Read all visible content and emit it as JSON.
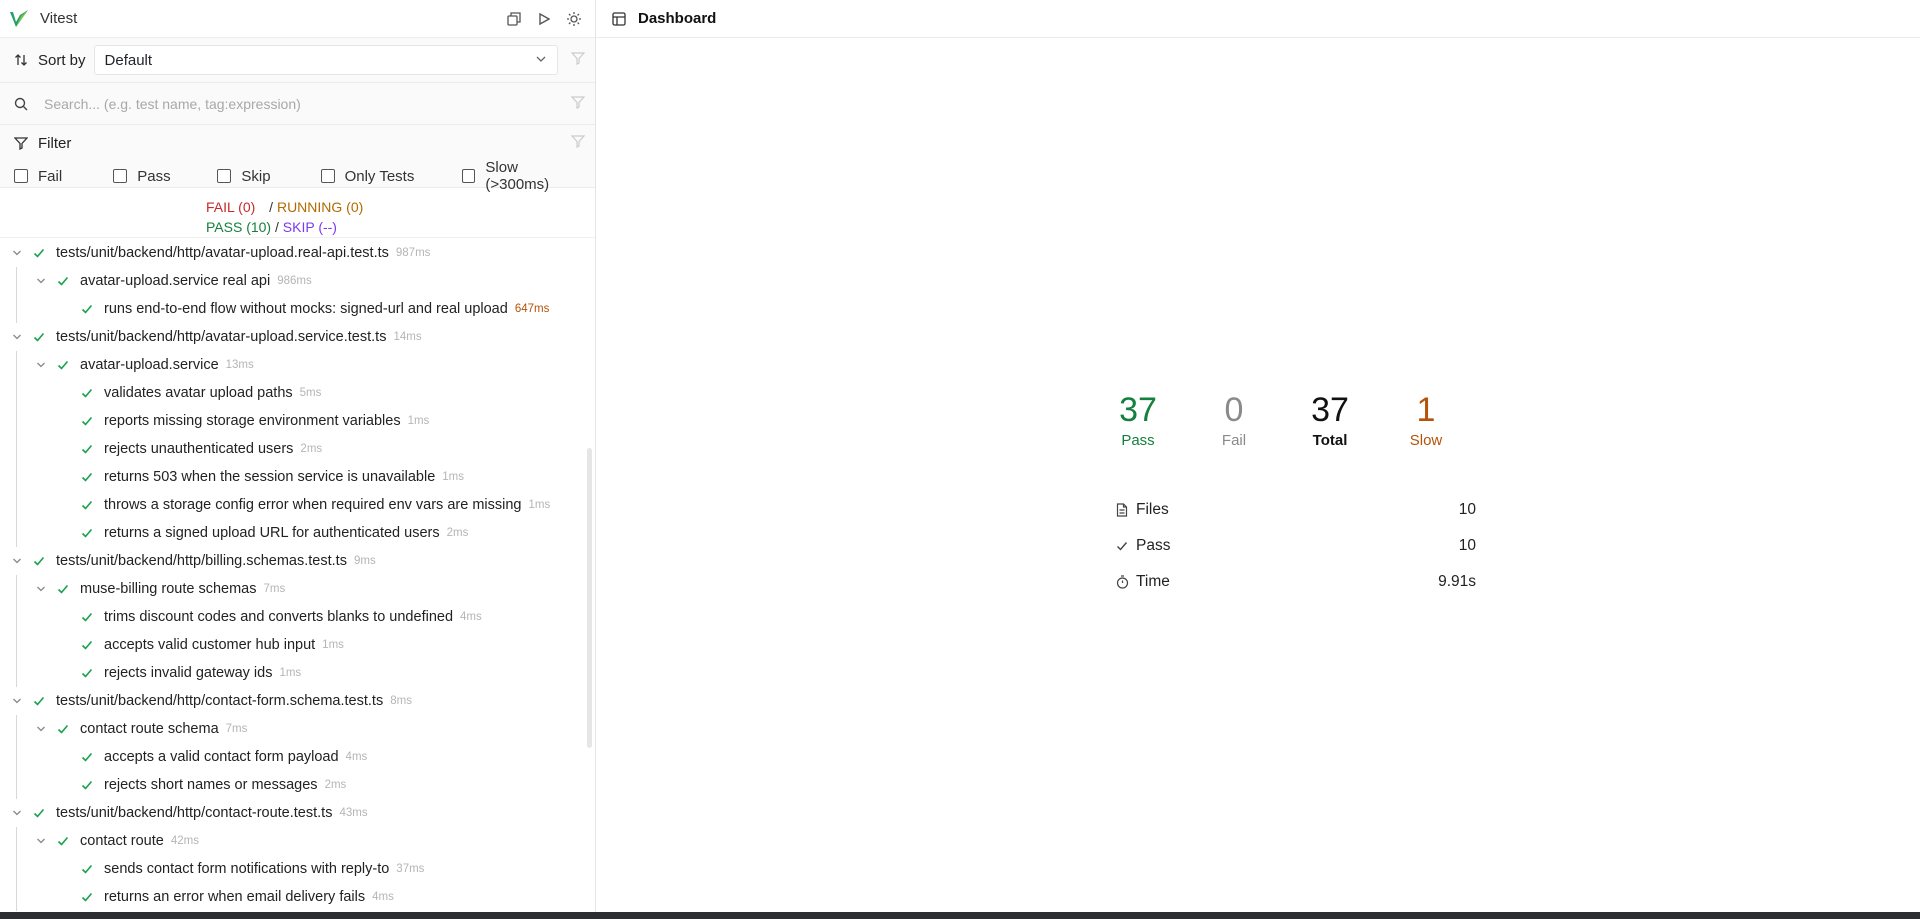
{
  "app": {
    "title": "Vitest"
  },
  "sidebar": {
    "sort_label": "Sort by",
    "sort_value": "Default",
    "search_placeholder": "Search... (e.g. test name, tag:expression)",
    "filter_title": "Filter",
    "filter_options": [
      "Fail",
      "Pass",
      "Skip",
      "Only Tests",
      "Slow (>300ms)"
    ],
    "summary": {
      "fail": "FAIL (0)",
      "sep1": "/",
      "running": "RUNNING (0)",
      "pass": "PASS (10)",
      "sep2": "/",
      "skip": "SKIP (--)"
    },
    "tree": [
      {
        "level": 0,
        "name": "tests/unit/backend/http/avatar-upload.real-api.test.ts",
        "dur": "987ms"
      },
      {
        "level": 1,
        "name": "avatar-upload.service real api",
        "dur": "986ms"
      },
      {
        "level": 2,
        "name": "runs end-to-end flow without mocks: signed-url and real upload",
        "dur": "647ms",
        "slow": true
      },
      {
        "level": 0,
        "name": "tests/unit/backend/http/avatar-upload.service.test.ts",
        "dur": "14ms"
      },
      {
        "level": 1,
        "name": "avatar-upload.service",
        "dur": "13ms"
      },
      {
        "level": 2,
        "name": "validates avatar upload paths",
        "dur": "5ms"
      },
      {
        "level": 2,
        "name": "reports missing storage environment variables",
        "dur": "1ms"
      },
      {
        "level": 2,
        "name": "rejects unauthenticated users",
        "dur": "2ms"
      },
      {
        "level": 2,
        "name": "returns 503 when the session service is unavailable",
        "dur": "1ms"
      },
      {
        "level": 2,
        "name": "throws a storage config error when required env vars are missing",
        "dur": "1ms"
      },
      {
        "level": 2,
        "name": "returns a signed upload URL for authenticated users",
        "dur": "2ms"
      },
      {
        "level": 0,
        "name": "tests/unit/backend/http/billing.schemas.test.ts",
        "dur": "9ms"
      },
      {
        "level": 1,
        "name": "muse-billing route schemas",
        "dur": "7ms"
      },
      {
        "level": 2,
        "name": "trims discount codes and converts blanks to undefined",
        "dur": "4ms"
      },
      {
        "level": 2,
        "name": "accepts valid customer hub input",
        "dur": "1ms"
      },
      {
        "level": 2,
        "name": "rejects invalid gateway ids",
        "dur": "1ms"
      },
      {
        "level": 0,
        "name": "tests/unit/backend/http/contact-form.schema.test.ts",
        "dur": "8ms"
      },
      {
        "level": 1,
        "name": "contact route schema",
        "dur": "7ms"
      },
      {
        "level": 2,
        "name": "accepts a valid contact form payload",
        "dur": "4ms"
      },
      {
        "level": 2,
        "name": "rejects short names or messages",
        "dur": "2ms"
      },
      {
        "level": 0,
        "name": "tests/unit/backend/http/contact-route.test.ts",
        "dur": "43ms"
      },
      {
        "level": 1,
        "name": "contact route",
        "dur": "42ms"
      },
      {
        "level": 2,
        "name": "sends contact form notifications with reply-to",
        "dur": "37ms"
      },
      {
        "level": 2,
        "name": "returns an error when email delivery fails",
        "dur": "4ms"
      }
    ]
  },
  "main": {
    "title": "Dashboard",
    "stats": [
      {
        "value": "37",
        "label": "Pass"
      },
      {
        "value": "0",
        "label": "Fail"
      },
      {
        "value": "37",
        "label": "Total"
      },
      {
        "value": "1",
        "label": "Slow"
      }
    ],
    "details": [
      {
        "icon": "file-icon",
        "label": "Files",
        "value": "10"
      },
      {
        "icon": "check-icon",
        "label": "Pass",
        "value": "10"
      },
      {
        "icon": "timer-icon",
        "label": "Time",
        "value": "9.91s"
      }
    ]
  },
  "colors": {
    "pass": "#15803d",
    "fail": "#c42b2b",
    "running": "#b26b00",
    "skip": "#7c3aed",
    "slow": "#b45309"
  }
}
